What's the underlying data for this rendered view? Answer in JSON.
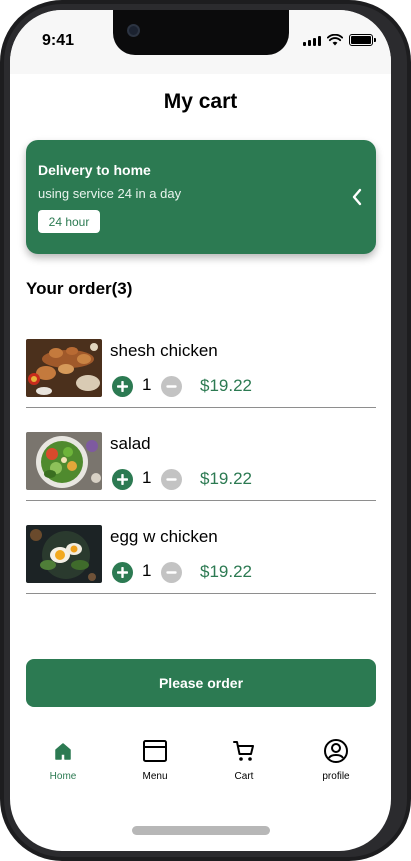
{
  "status_bar": {
    "time": "9:41"
  },
  "header": {
    "title": "My cart"
  },
  "delivery": {
    "title": "Delivery to home",
    "subtitle": "using service 24 in a day",
    "badge": "24 hour",
    "chevron_icon": "chevron-left-icon"
  },
  "order": {
    "heading": "Your order(3)",
    "items": [
      {
        "name": "shesh chicken",
        "quantity": "1",
        "price": "$19.22"
      },
      {
        "name": "salad",
        "quantity": "1",
        "price": "$19.22"
      },
      {
        "name": "egg w chicken",
        "quantity": "1",
        "price": "$19.22"
      }
    ]
  },
  "cta": {
    "label": "Please order"
  },
  "nav": {
    "items": [
      {
        "label": "Home",
        "icon": "home-icon",
        "active": true
      },
      {
        "label": "Menu",
        "icon": "menu-icon",
        "active": false
      },
      {
        "label": "Cart",
        "icon": "cart-icon",
        "active": false
      },
      {
        "label": "profile",
        "icon": "profile-icon",
        "active": false
      }
    ]
  },
  "colors": {
    "accent": "#2c7a52",
    "inactive": "#c3c3c3",
    "divider": "#8e8e8e"
  }
}
